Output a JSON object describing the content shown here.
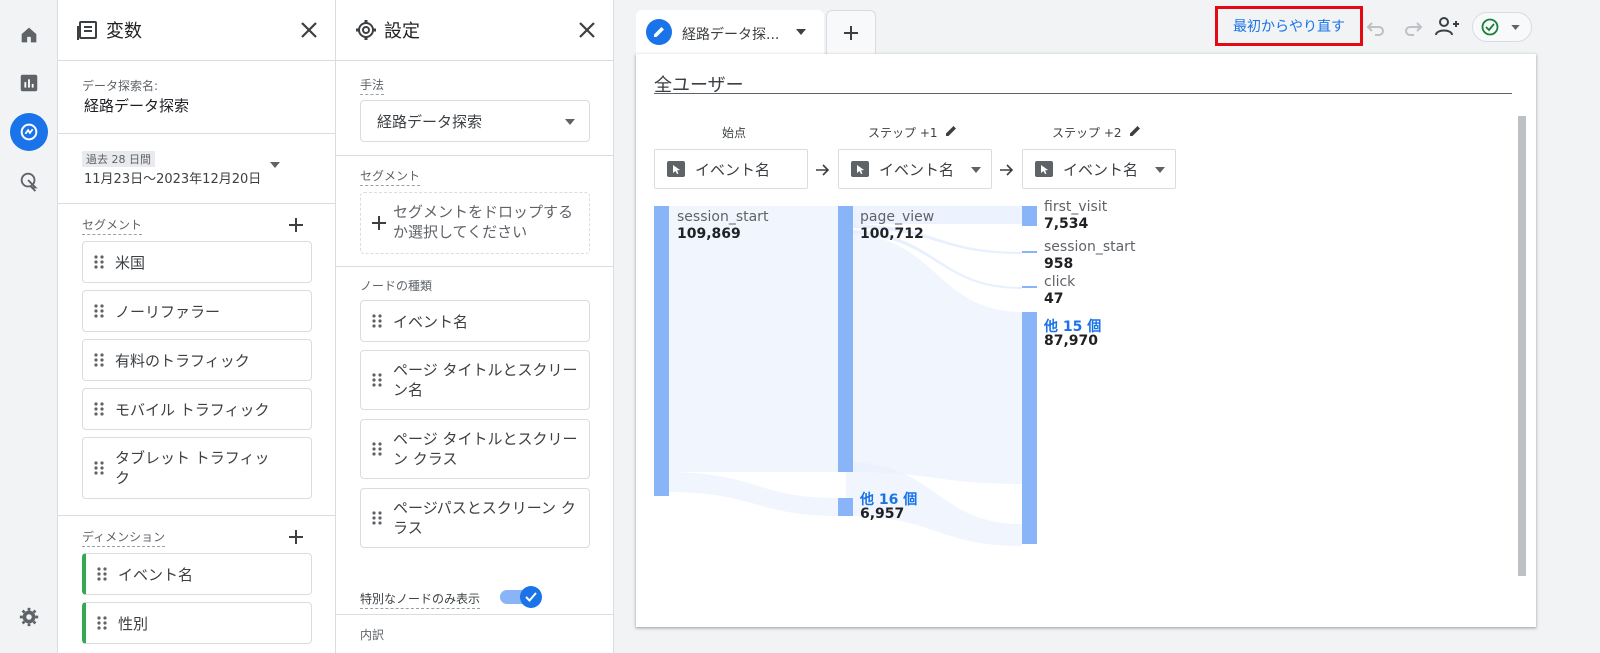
{
  "nav": {
    "items": [
      {
        "name": "home-icon"
      },
      {
        "name": "reports-icon"
      },
      {
        "name": "explore-icon"
      },
      {
        "name": "advertising-icon"
      }
    ],
    "settings_icon": "gear-icon"
  },
  "variables": {
    "title": "変数",
    "exploration_name_label": "データ探索名:",
    "exploration_name": "経路データ探索",
    "date_badge": "過去 28 日間",
    "date_range": "11月23日〜2023年12月20日",
    "segments_label": "セグメント",
    "segments": [
      "米国",
      "ノーリファラー",
      "有料のトラフィック",
      "モバイル トラフィック",
      "タブレット トラフィック"
    ],
    "dimensions_label": "ディメンション",
    "dimensions": [
      "イベント名",
      "性別"
    ]
  },
  "settings": {
    "title": "設定",
    "technique_label": "手法",
    "technique_value": "経路データ探索",
    "segment_label": "セグメント",
    "segment_drop_text": "セグメントをドロップするか選択してください",
    "node_type_label": "ノードの種類",
    "node_types": [
      "イベント名",
      "ページ タイトルとスクリーン名",
      "ページ タイトルとスクリーン クラス",
      "ページパスとスクリーン クラス"
    ],
    "unique_nodes_label": "特別なノードのみ表示",
    "breakdown_label": "内訳"
  },
  "canvas": {
    "tab_label": "経路データ探...",
    "restart_label": "最初からやり直す",
    "segment_title": "全ユーザー",
    "columns": [
      {
        "label": "始点",
        "dimension": "イベント名"
      },
      {
        "label": "ステップ +1",
        "dimension": "イベント名"
      },
      {
        "label": "ステップ +2",
        "dimension": "イベント名"
      }
    ],
    "nodes": {
      "start": {
        "name": "session_start",
        "value": "109,869"
      },
      "step1_main": {
        "name": "page_view",
        "value": "100,712"
      },
      "step1_other": {
        "name": "他 16 個",
        "value": "6,957"
      },
      "step2_a": {
        "name": "first_visit",
        "value": "7,534"
      },
      "step2_b": {
        "name": "session_start",
        "value": "958"
      },
      "step2_c": {
        "name": "click",
        "value": "47"
      },
      "step2_other": {
        "name": "他 15 個",
        "value": "87,970"
      }
    }
  },
  "colors": {
    "accent": "#1a73e8",
    "node_bar": "#8ab4f8",
    "restart_border": "#e50914"
  }
}
